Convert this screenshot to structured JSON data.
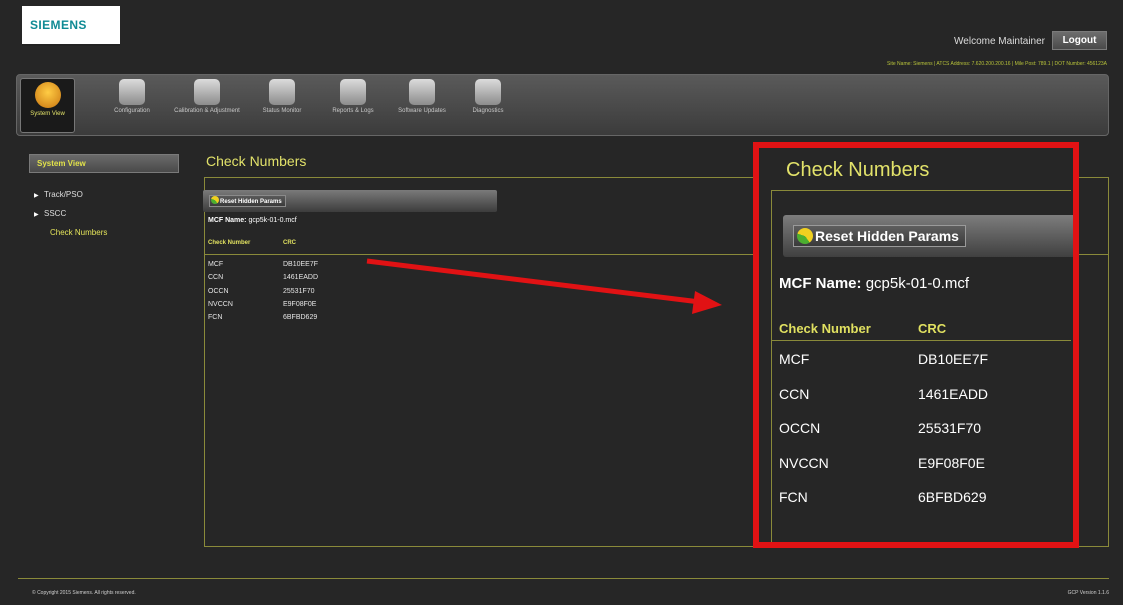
{
  "header": {
    "logo": "SIEMENS",
    "welcome": "Welcome Maintainer",
    "logout_label": "Logout",
    "site_info": "Site Name: Siemens | ATCS Address: 7.620.200.200.16 | Mile Post: 789.1 | DOT Number: 456123A"
  },
  "toolbar": {
    "items": [
      {
        "label": "System View",
        "icon": "house-icon",
        "active": true
      },
      {
        "label": "Configuration",
        "icon": "gears-icon"
      },
      {
        "label": "Calibration & Adjustment",
        "icon": "calibration-tools-icon"
      },
      {
        "label": "Status Monitor",
        "icon": "monitor-icon"
      },
      {
        "label": "Reports & Logs",
        "icon": "document-icon"
      },
      {
        "label": "Software Updates",
        "icon": "software-update-icon"
      },
      {
        "label": "Diagnostics",
        "icon": "magnifier-icon"
      }
    ]
  },
  "sidebar": {
    "title": "System View",
    "items": [
      {
        "label": "Track/PSO",
        "expandable": true
      },
      {
        "label": "SSCC",
        "expandable": true
      },
      {
        "label": "Check Numbers",
        "selected": true
      }
    ]
  },
  "main": {
    "title": "Check Numbers",
    "reset_button": "Reset Hidden Params",
    "mcf_label": "MCF Name:",
    "mcf_value": "gcp5k-01-0.mcf",
    "columns": [
      "Check Number",
      "CRC"
    ],
    "rows": [
      {
        "name": "MCF",
        "crc": "DB10EE7F"
      },
      {
        "name": "CCN",
        "crc": "1461EADD"
      },
      {
        "name": "OCCN",
        "crc": "25531F70"
      },
      {
        "name": "NVCCN",
        "crc": "E9F08F0E"
      },
      {
        "name": "FCN",
        "crc": "6BFBD629"
      }
    ]
  },
  "footer": {
    "copyright": "© Copyright 2015 Siemens. All rights reserved.",
    "version": "GCP Version 1.1.6"
  },
  "colors": {
    "accent": "#e2e26a",
    "callout": "#e11214",
    "background": "#262626"
  }
}
